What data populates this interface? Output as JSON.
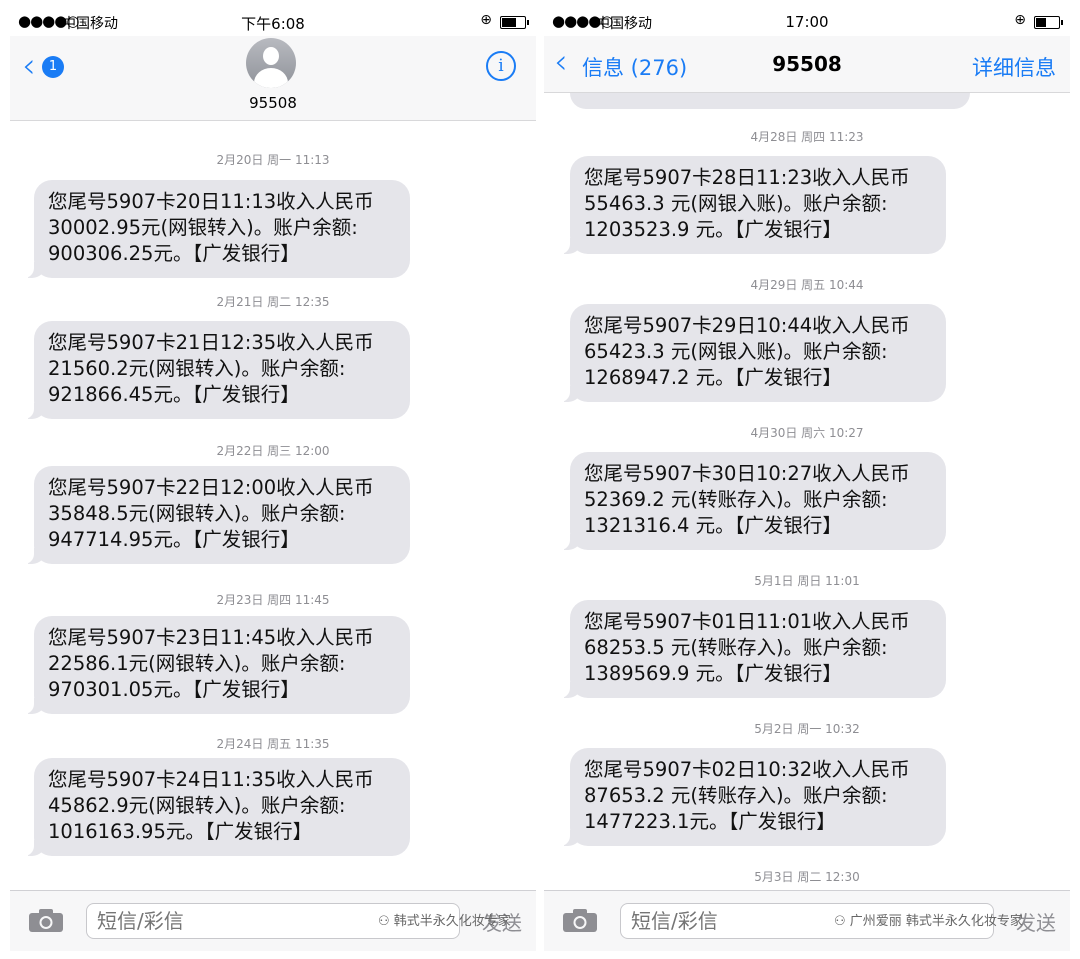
{
  "left": {
    "status": {
      "signal": "●●●●○",
      "carrier": "中国移动",
      "time": "下午6:08"
    },
    "nav": {
      "badge": "1",
      "contact": "95508",
      "info_icon": "i"
    },
    "messages": [
      {
        "date": "2月20日 周一 11:13",
        "lines": [
          "您尾号5907卡20日11:13收入人民币",
          "30002.95元(网银转入)。账户余额:",
          "900306.25元。【广发银行】"
        ]
      },
      {
        "date": "2月21日 周二 12:35",
        "lines": [
          "您尾号5907卡21日12:35收入人民币",
          "21560.2元(网银转入)。账户余额:",
          "921866.45元。【广发银行】"
        ]
      },
      {
        "date": "2月22日 周三 12:00",
        "lines": [
          "您尾号5907卡22日12:00收入人民币",
          "35848.5元(网银转入)。账户余额:",
          "947714.95元。【广发银行】"
        ]
      },
      {
        "date": "2月23日 周四 11:45",
        "lines": [
          "您尾号5907卡23日11:45收入人民币",
          "22586.1元(网银转入)。账户余额:",
          "970301.05元。【广发银行】"
        ]
      },
      {
        "date": "2月24日 周五 11:35",
        "lines": [
          "您尾号5907卡24日11:35收入人民币",
          "45862.9元(网银转入)。账户余额:",
          "1016163.95元。【广发银行】"
        ]
      }
    ],
    "input": {
      "placeholder": "短信/彩信",
      "send": "发送",
      "watermark": "韩式半永久化妆专家"
    }
  },
  "right": {
    "status": {
      "signal": "●●●●○",
      "carrier": "中国移动",
      "time": "17:00"
    },
    "nav": {
      "back_label": "信息 (276)",
      "contact": "95508",
      "detail": "详细信息"
    },
    "messages": [
      {
        "date": "4月28日 周四 11:23",
        "lines": [
          "您尾号5907卡28日11:23收入人民币",
          "55463.3 元(网银入账)。账户余额:",
          "1203523.9 元。【广发银行】"
        ]
      },
      {
        "date": "4月29日 周五 10:44",
        "lines": [
          "您尾号5907卡29日10:44收入人民币",
          "65423.3 元(网银入账)。账户余额:",
          "1268947.2 元。【广发银行】"
        ]
      },
      {
        "date": "4月30日 周六 10:27",
        "lines": [
          "您尾号5907卡30日10:27收入人民币",
          "52369.2 元(转账存入)。账户余额:",
          "1321316.4 元。【广发银行】"
        ]
      },
      {
        "date": "5月1日 周日 11:01",
        "lines": [
          "您尾号5907卡01日11:01收入人民币",
          "68253.5 元(转账存入)。账户余额:",
          "1389569.9 元。【广发银行】"
        ]
      },
      {
        "date": "5月2日 周一 10:32",
        "lines": [
          "您尾号5907卡02日10:32收入人民币",
          "87653.2 元(转账存入)。账户余额:",
          "1477223.1元。【广发银行】"
        ]
      }
    ],
    "last_date": "5月3日 周二 12:30",
    "input": {
      "placeholder": "短信/彩信",
      "send": "发送",
      "watermark": "广州爱丽 韩式半永久化妆专家"
    }
  },
  "colors": {
    "accent": "#1a7cf5",
    "bubble": "#e5e5ea",
    "date_text": "#8e8e93"
  },
  "icons": [
    "back-chevron-icon",
    "unread-badge",
    "contact-avatar-icon",
    "info-icon",
    "camera-icon",
    "wechat-watermark-icon"
  ]
}
